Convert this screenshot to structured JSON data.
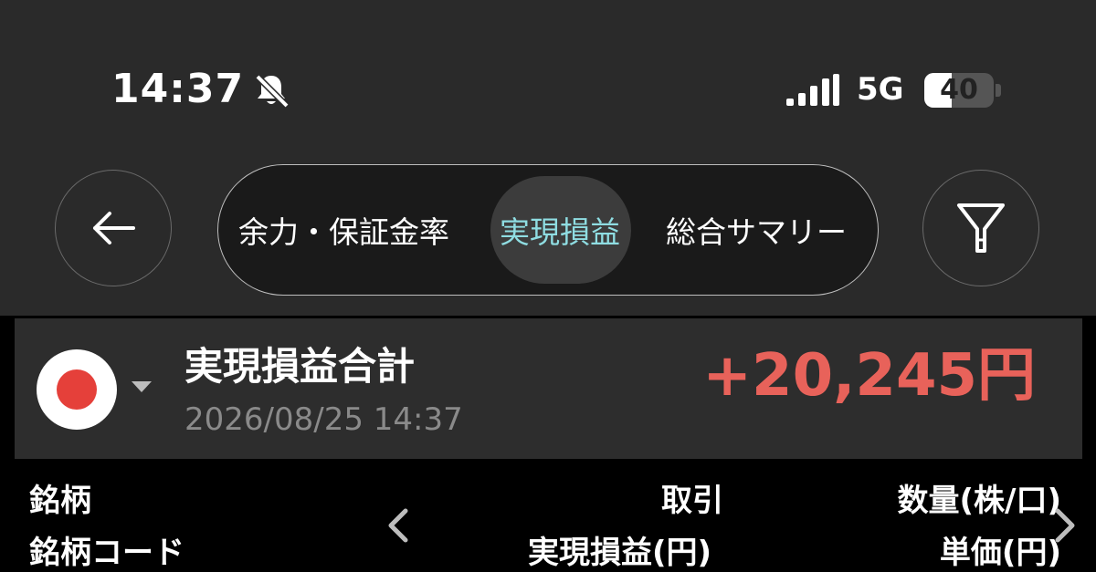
{
  "status_bar": {
    "time": "14:37",
    "network": "5G",
    "battery_level": "40",
    "battery_fraction": 0.4,
    "icons": [
      "bell-slash-icon",
      "signal-icon"
    ]
  },
  "nav": {
    "tabs": [
      {
        "label": "余力・保証金率",
        "active": false
      },
      {
        "label": "実現損益",
        "active": true
      },
      {
        "label": "総合サマリー",
        "active": false
      }
    ],
    "icons": [
      "back-arrow-icon",
      "filter-icon"
    ]
  },
  "summary": {
    "title": "実現損益合計",
    "timestamp": "2026/08/25 14:37",
    "amount": "+20,245円",
    "market_icon": "japan-flag-icon"
  },
  "table_header": {
    "row1": {
      "col1": "銘柄",
      "col2": "取引",
      "col3": "数量(株/口)"
    },
    "row2": {
      "col1": "銘柄コード",
      "col2": "実現損益(円)",
      "col3": "単価(円)"
    }
  },
  "colors": {
    "accent": "#8fdde2",
    "profit": "#e8625a",
    "header_bg": "#2a2a2a",
    "card_bg": "#2d2d2d"
  }
}
